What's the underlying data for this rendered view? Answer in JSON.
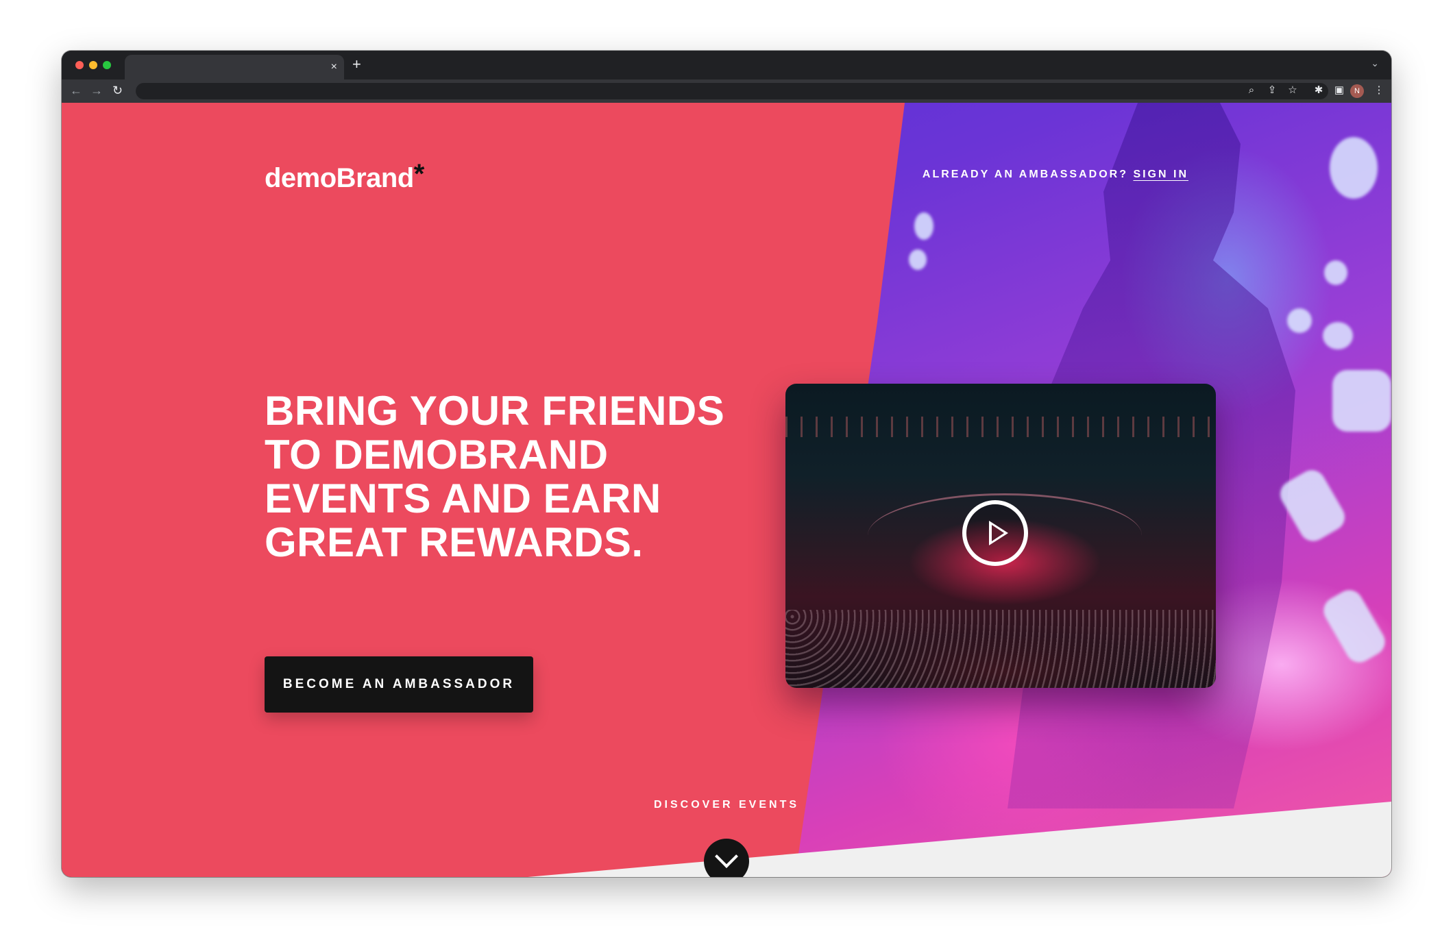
{
  "browser": {
    "tab_close": "×",
    "new_tab": "+",
    "tabs_menu": "⌄",
    "nav": {
      "back": "←",
      "forward": "→",
      "reload": "↻"
    },
    "toolbar_icons": {
      "zoom": "⌕",
      "share": "⇪",
      "bookmark": "☆",
      "extensions": "✱",
      "sidepanel": "▣",
      "menu": "⋮"
    },
    "profile_initial": "N"
  },
  "hero": {
    "logo_text": "demoBrand",
    "logo_mark": "*",
    "signin_prompt": "ALREADY AN AMBASSADOR? ",
    "signin_link": "SIGN IN",
    "headline_lines": [
      "BRING YOUR FRIENDS",
      "TO DEMOBRAND",
      "EVENTS AND EARN",
      "GREAT REWARDS."
    ],
    "cta_label": "BECOME AN AMBASSADOR",
    "discover_label": "DISCOVER EVENTS"
  },
  "colors": {
    "hero_background": "#ec4a5e",
    "button_background": "#141414",
    "text": "#ffffff"
  }
}
